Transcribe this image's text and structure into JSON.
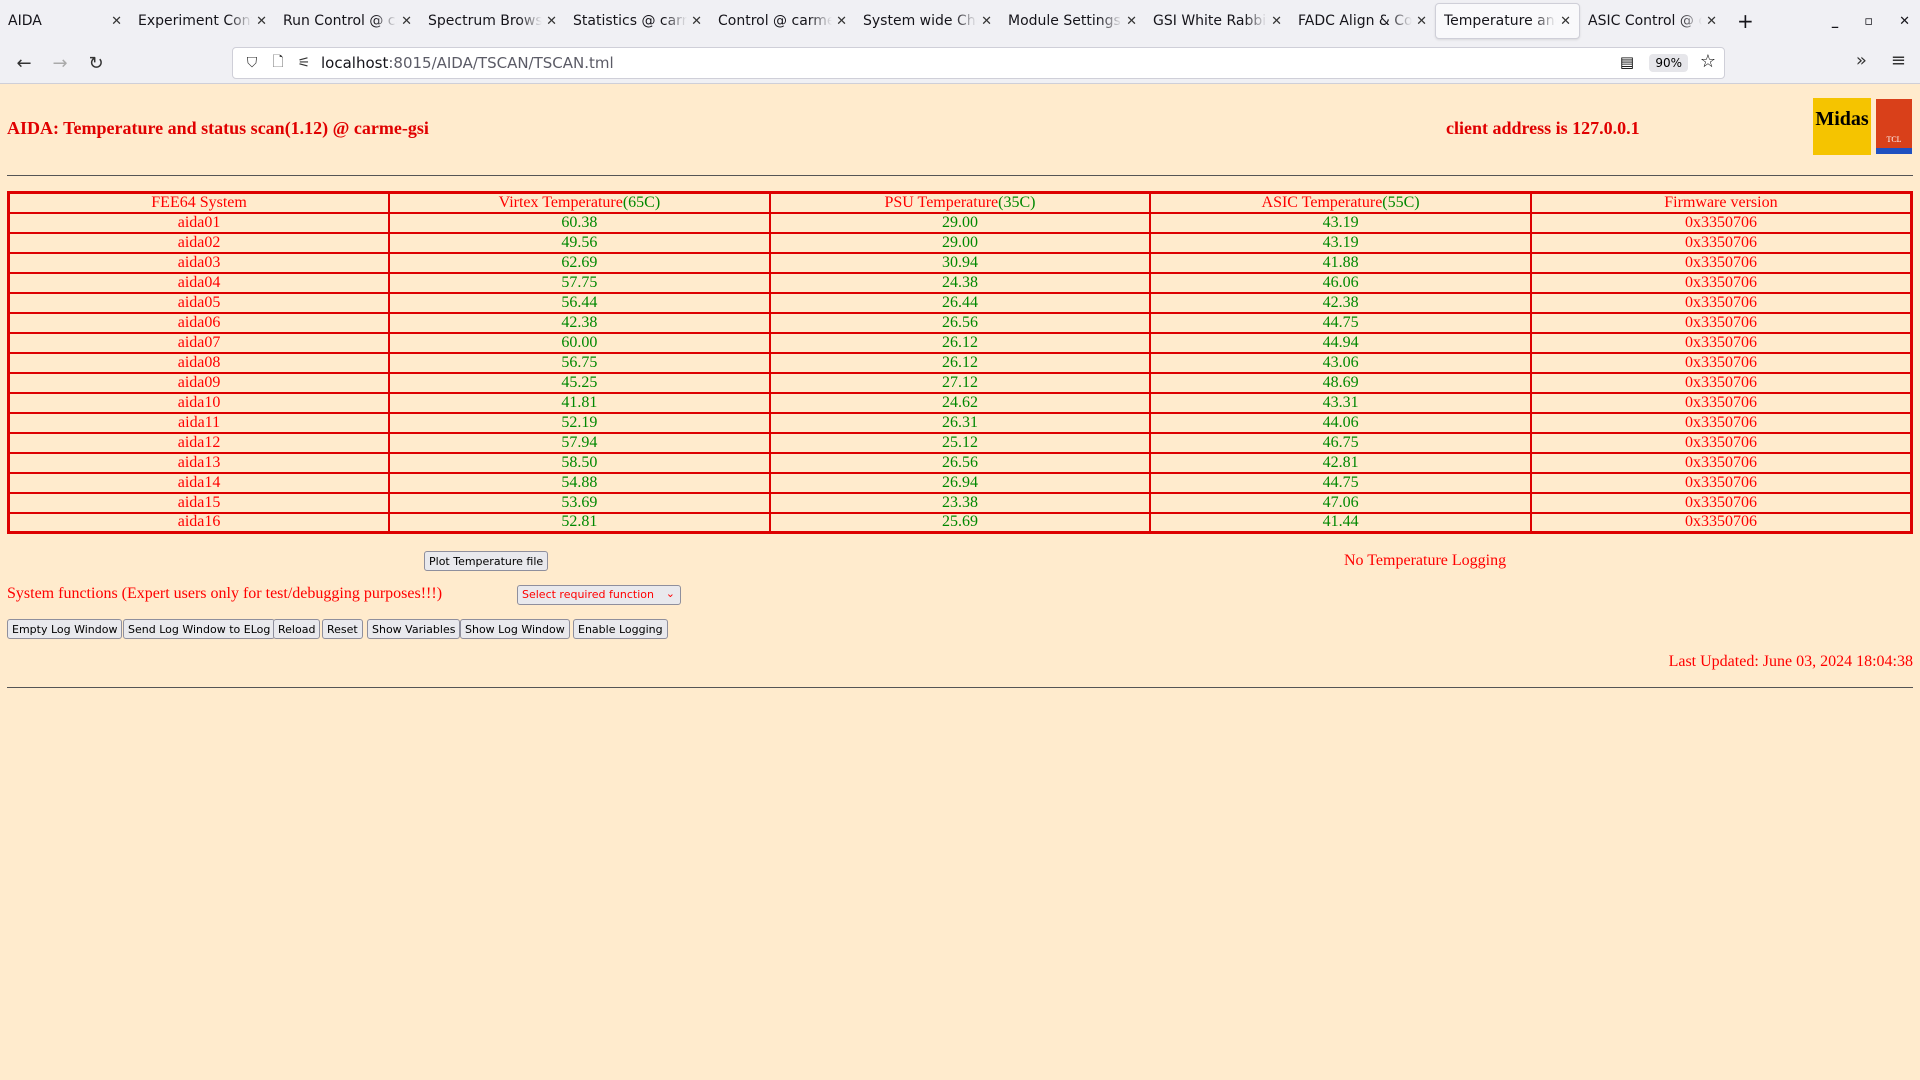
{
  "browser": {
    "tabs": [
      {
        "title": "AIDA",
        "active": false
      },
      {
        "title": "Experiment Control",
        "active": false
      },
      {
        "title": "Run Control @ carme",
        "active": false
      },
      {
        "title": "Spectrum Browser",
        "active": false
      },
      {
        "title": "Statistics @ carme",
        "active": false
      },
      {
        "title": "Control @ carme",
        "active": false
      },
      {
        "title": "System wide Checks",
        "active": false
      },
      {
        "title": "Module Settings",
        "active": false
      },
      {
        "title": "GSI White Rabbit",
        "active": false
      },
      {
        "title": "FADC Align & Control",
        "active": false
      },
      {
        "title": "Temperature and",
        "active": true
      },
      {
        "title": "ASIC Control @ c",
        "active": false
      }
    ],
    "url_host": "localhost",
    "url_path": ":8015/AIDA/TSCAN/TSCAN.tml",
    "zoom": "90%"
  },
  "page": {
    "title": "AIDA: Temperature and status scan(1.12) @ carme-gsi",
    "client_address": "client address is 127.0.0.1",
    "logos": [
      "Midas",
      "TCL POWERED"
    ],
    "table": {
      "headers": [
        {
          "label": "FEE64 System",
          "limit": ""
        },
        {
          "label": "Virtex Temperature",
          "limit": "(65C)"
        },
        {
          "label": "PSU Temperature",
          "limit": "(35C)"
        },
        {
          "label": "ASIC Temperature",
          "limit": "(55C)"
        },
        {
          "label": "Firmware version",
          "limit": ""
        }
      ],
      "rows": [
        [
          "aida01",
          "60.38",
          "29.00",
          "43.19",
          "0x3350706"
        ],
        [
          "aida02",
          "49.56",
          "29.00",
          "43.19",
          "0x3350706"
        ],
        [
          "aida03",
          "62.69",
          "30.94",
          "41.88",
          "0x3350706"
        ],
        [
          "aida04",
          "57.75",
          "24.38",
          "46.06",
          "0x3350706"
        ],
        [
          "aida05",
          "56.44",
          "26.44",
          "42.38",
          "0x3350706"
        ],
        [
          "aida06",
          "42.38",
          "26.56",
          "44.75",
          "0x3350706"
        ],
        [
          "aida07",
          "60.00",
          "26.12",
          "44.94",
          "0x3350706"
        ],
        [
          "aida08",
          "56.75",
          "26.12",
          "43.06",
          "0x3350706"
        ],
        [
          "aida09",
          "45.25",
          "27.12",
          "48.69",
          "0x3350706"
        ],
        [
          "aida10",
          "41.81",
          "24.62",
          "43.31",
          "0x3350706"
        ],
        [
          "aida11",
          "52.19",
          "26.31",
          "44.06",
          "0x3350706"
        ],
        [
          "aida12",
          "57.94",
          "25.12",
          "46.75",
          "0x3350706"
        ],
        [
          "aida13",
          "58.50",
          "26.56",
          "42.81",
          "0x3350706"
        ],
        [
          "aida14",
          "54.88",
          "26.94",
          "44.75",
          "0x3350706"
        ],
        [
          "aida15",
          "53.69",
          "23.38",
          "47.06",
          "0x3350706"
        ],
        [
          "aida16",
          "52.81",
          "25.69",
          "41.44",
          "0x3350706"
        ]
      ]
    },
    "plot_button": "Plot Temperature file",
    "logging_status": "No Temperature Logging",
    "system_functions": "System functions (Expert users only for test/debugging purposes!!!)",
    "function_select": "Select required function",
    "buttons": [
      "Empty Log Window",
      "Send Log Window to ELog",
      "Reload",
      "Reset",
      "Show Variables",
      "Show Log Window",
      "Enable Logging"
    ],
    "last_updated": "Last Updated: June 03, 2024 18:04:38"
  },
  "colors": {
    "text": "#ff0000",
    "value": "#008800",
    "border": "#dd0000",
    "background": "#ffebcd"
  }
}
